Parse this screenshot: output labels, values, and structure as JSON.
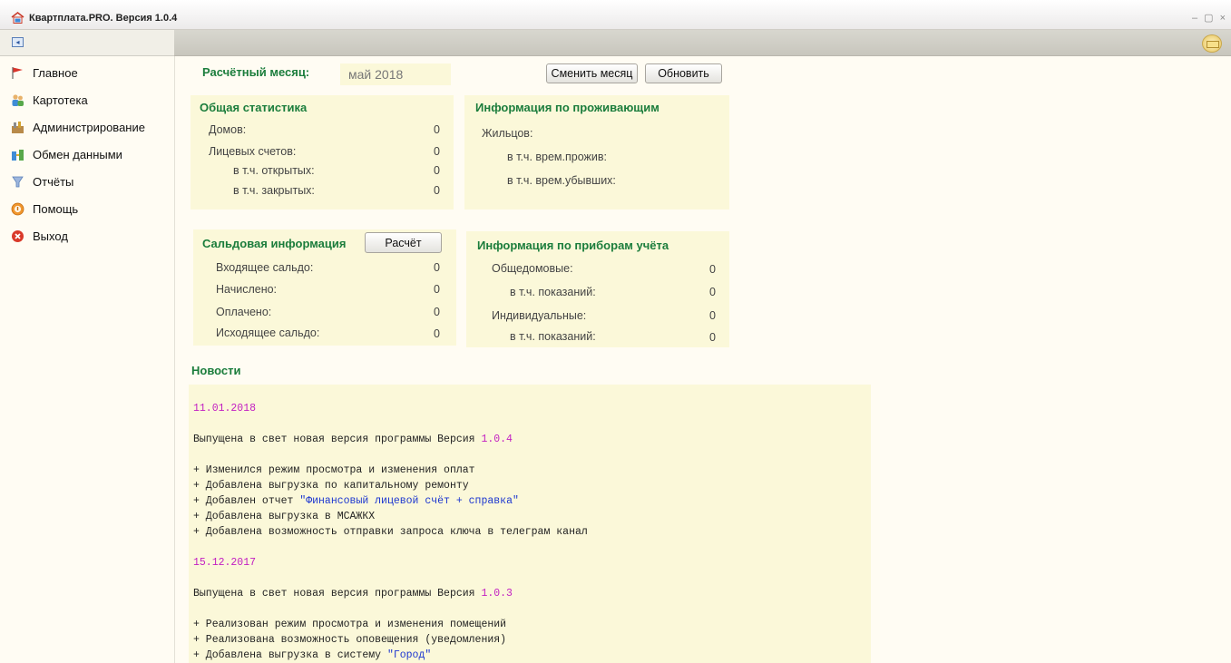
{
  "window": {
    "title": "Квартплата.PRO. Версия 1.0.4",
    "controls": "– ▢ ×"
  },
  "sidebar": {
    "collapse_icon": "sidebar-collapse-icon",
    "items": [
      {
        "label": "Главное",
        "icon": "red-flag-icon"
      },
      {
        "label": "Картотека",
        "icon": "people-icon"
      },
      {
        "label": "Администрирование",
        "icon": "admin-tools-icon"
      },
      {
        "label": "Обмен данными",
        "icon": "data-exchange-icon"
      },
      {
        "label": "Отчёты",
        "icon": "reports-icon"
      },
      {
        "label": "Помощь",
        "icon": "help-icon"
      },
      {
        "label": "Выход",
        "icon": "exit-icon"
      }
    ]
  },
  "topbar": {
    "mail_icon": "mail-icon"
  },
  "header": {
    "month_label": "Расчётный месяц:",
    "month_value": "май 2018",
    "change_month_button": "Сменить месяц",
    "refresh_button": "Обновить"
  },
  "general_stats": {
    "title": "Общая статистика",
    "rows": [
      {
        "label": "Домов:",
        "value": "0"
      },
      {
        "label": "Лицевых счетов:",
        "value": "0"
      },
      {
        "label": "в т.ч. открытых:",
        "value": "0"
      },
      {
        "label": "в т.ч. закрытых:",
        "value": "0"
      }
    ]
  },
  "residents": {
    "title": "Информация по проживающим",
    "rows": [
      {
        "label": "Жильцов:"
      },
      {
        "label": "в т.ч. врем.прожив:"
      },
      {
        "label": "в т.ч. врем.убывших:"
      }
    ]
  },
  "balance": {
    "title": "Сальдовая информация",
    "calc_button": "Расчёт",
    "rows": [
      {
        "label": "Входящее сальдо:",
        "value": "0"
      },
      {
        "label": "Начислено:",
        "value": "0"
      },
      {
        "label": "Оплачено:",
        "value": "0"
      },
      {
        "label": "Исходящее сальдо:",
        "value": "0"
      }
    ]
  },
  "meters": {
    "title": "Информация по приборам учёта",
    "rows": [
      {
        "label": "Общедомовые:",
        "value": "0"
      },
      {
        "label": "в т.ч. показаний:",
        "value": "0"
      },
      {
        "label": "Индивидуальные:",
        "value": "0"
      },
      {
        "label": "в т.ч. показаний:",
        "value": "0"
      }
    ]
  },
  "news": {
    "title": "Новости",
    "entries": [
      {
        "date": "11.01.2018",
        "release_prefix": "Выпущена в свет новая версия программы Версия ",
        "version": "1.0.4",
        "items": [
          {
            "text": "+ Изменился режим просмотра и изменения оплат"
          },
          {
            "text": "+ Добавлена выгрузка по капитальному ремонту"
          },
          {
            "text": "+ Добавлен отчет ",
            "quoted": "\"Финансовый лицевой счёт + справка\""
          },
          {
            "text": "+ Добавлена выгрузка в МСАЖКХ"
          },
          {
            "text": "+ Добавлена возможность отправки запроса ключа в телеграм канал"
          }
        ]
      },
      {
        "date": "15.12.2017",
        "release_prefix": "Выпущена в свет новая версия программы Версия ",
        "version": "1.0.3",
        "items": [
          {
            "text": "+ Реализован режим просмотра и изменения помещений"
          },
          {
            "text": "+ Реализована возможность оповещения (уведомления)"
          },
          {
            "text": "+ Добавлена выгрузка в систему ",
            "quoted": "\"Город\""
          }
        ]
      }
    ]
  }
}
